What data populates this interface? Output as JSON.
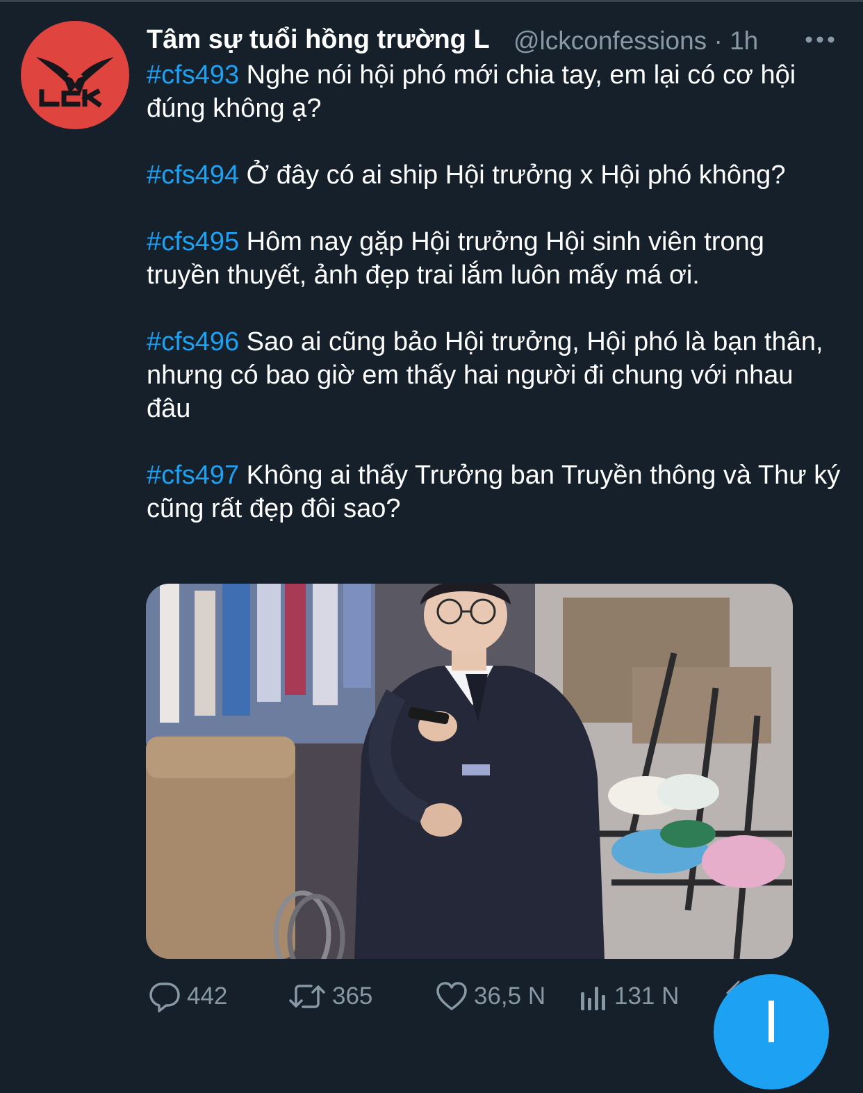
{
  "tweet": {
    "author": {
      "display_name": "Tâm sự tuổi hồng trường L",
      "handle": "@lckconfessions",
      "separator": "·",
      "time": "1h",
      "avatar_text": "LCK"
    },
    "posts": [
      {
        "tag": "#cfs493",
        "text": "Nghe nói hội phó mới chia tay, em lại có cơ hội đúng không ạ?"
      },
      {
        "tag": "#cfs494",
        "text": "Ở đây có ai ship Hội trưởng x Hội phó không?"
      },
      {
        "tag": "#cfs495",
        "text": "Hôm nay gặp Hội trưởng Hội sinh viên trong truyền thuyết, ảnh đẹp trai lắm luôn mấy má ơi."
      },
      {
        "tag": "#cfs496",
        "text": "Sao ai cũng bảo Hội trưởng, Hội phó là bạn thân, nhưng có bao giờ em thấy hai người đi chung với nhau đâu"
      },
      {
        "tag": "#cfs497",
        "text": "Không ai thấy Trưởng ban Truyền thông và Thư ký cũng rất đẹp đôi sao?"
      }
    ],
    "actions": {
      "replies": "442",
      "retweets": "365",
      "likes": "36,5 N",
      "views": "131 N"
    }
  },
  "colors": {
    "background": "#15202b",
    "text": "#ffffff",
    "secondary_text": "#8899a6",
    "link": "#1da1f2",
    "avatar_bg": "#e0443f",
    "fab": "#1da1f2"
  },
  "icons": {
    "more": "more-dots-icon",
    "reply": "reply-bubble-icon",
    "retweet": "retweet-arrows-icon",
    "like": "heart-icon",
    "views": "bar-chart-icon",
    "compose": "compose-fab"
  }
}
